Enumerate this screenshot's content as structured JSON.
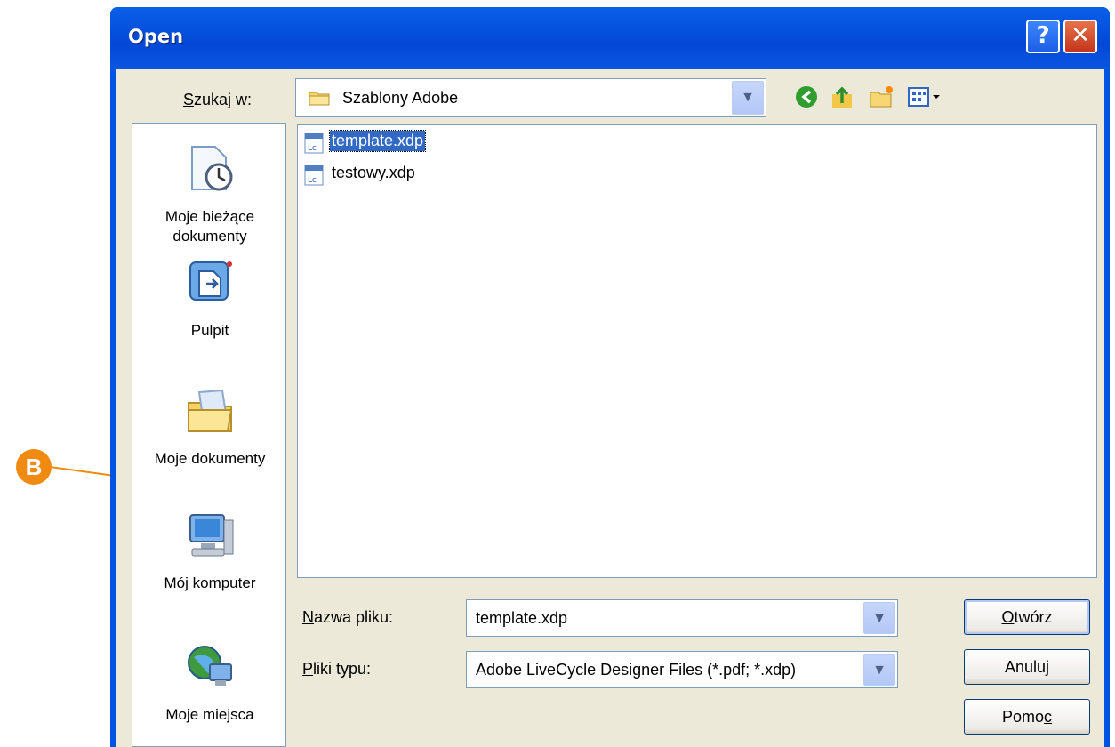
{
  "window": {
    "title": "Open"
  },
  "lookin": {
    "label_prefix": "",
    "label_underline": "S",
    "label_rest": "zukaj w:",
    "value": "Szablony Adobe"
  },
  "toolbar": {
    "icons": [
      "back-icon",
      "up-folder-icon",
      "new-folder-icon",
      "views-menu-icon"
    ]
  },
  "places": [
    {
      "line1": "Moje bieżące",
      "line2": "dokumenty",
      "icon": "recent-documents-icon"
    },
    {
      "line1": "Pulpit",
      "line2": "",
      "icon": "desktop-icon"
    },
    {
      "line1": "Moje dokumenty",
      "line2": "",
      "icon": "my-documents-icon"
    },
    {
      "line1": "Mój komputer",
      "line2": "",
      "icon": "my-computer-icon"
    },
    {
      "line1": "Moje miejsca",
      "line2": "",
      "icon": "network-places-icon"
    }
  ],
  "files": [
    {
      "name": "template.xdp",
      "selected": true
    },
    {
      "name": "testowy.xdp",
      "selected": false
    }
  ],
  "filename": {
    "label_u": "N",
    "label_rest": "azwa pliku:",
    "value": "template.xdp"
  },
  "filetype": {
    "label_u": "P",
    "label_rest": "liki typu:",
    "value": "Adobe LiveCycle Designer Files (*.pdf; *.xdp)"
  },
  "buttons": {
    "open_u": "O",
    "open_rest": "twórz",
    "cancel": "Anuluj",
    "help_pre": "Pomo",
    "help_u": "c"
  },
  "callout": {
    "badge": "B"
  },
  "colors": {
    "titlebar": "#0054e3",
    "selection": "#316ac5",
    "callout": "#f08a10",
    "face": "#ece9d8"
  }
}
